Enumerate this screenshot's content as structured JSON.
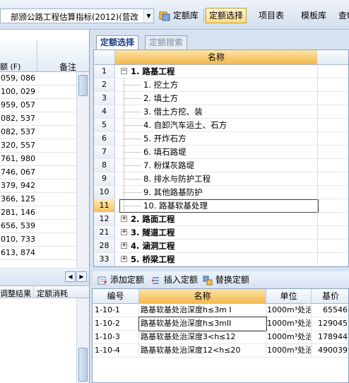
{
  "toolbar": {
    "project_combo": "部颁公路工程估算指标(2012)(营改",
    "btn_quota_lib": "定额库",
    "btn_quota_select": "定额选择",
    "btn_project_table": "项目表",
    "btn_template_lib": "模板库",
    "btn_cut": "查t"
  },
  "left_panel": {
    "header_col1": "额 (F)",
    "header_col2": "备注",
    "rows": [
      "059, 086",
      "100, 029",
      "959, 057",
      "082, 537",
      "082, 537",
      "320, 557",
      "761, 980",
      "746, 067",
      "379, 942",
      "366, 125",
      "281, 146",
      "656, 539",
      "010, 733",
      "613, 874"
    ],
    "bottom_header_col1": "调整结果",
    "bottom_header_col2": "定额消耗"
  },
  "tabs": {
    "quota_select": "定额选择",
    "quota_search": "定额搜索"
  },
  "tree": {
    "header": "名称",
    "rows": [
      {
        "num": "1",
        "label": "1. 路基工程",
        "level": 0,
        "expander": "−",
        "bold": true
      },
      {
        "num": "2",
        "label": "1. 挖土方",
        "level": 1
      },
      {
        "num": "3",
        "label": "2. 填土方",
        "level": 1
      },
      {
        "num": "4",
        "label": "3. 借土方挖、装",
        "level": 1
      },
      {
        "num": "5",
        "label": "4. 自卸汽车运土、石方",
        "level": 1
      },
      {
        "num": "6",
        "label": "5. 开炸石方",
        "level": 1
      },
      {
        "num": "7",
        "label": "6. 填石路堤",
        "level": 1
      },
      {
        "num": "8",
        "label": "7. 粉煤灰路堤",
        "level": 1
      },
      {
        "num": "9",
        "label": "8. 排水与防护工程",
        "level": 1
      },
      {
        "num": "10",
        "label": "9. 其他路基防护",
        "level": 1
      },
      {
        "num": "11",
        "label": "10. 路基软基处理",
        "level": 1,
        "selected": true
      },
      {
        "num": "12",
        "label": "2. 路面工程",
        "level": 0,
        "expander": "+",
        "bold": true
      },
      {
        "num": "21",
        "label": "3. 隧道工程",
        "level": 0,
        "expander": "+",
        "bold": true
      },
      {
        "num": "28",
        "label": "4. 涵洞工程",
        "level": 0,
        "expander": "+",
        "bold": true
      },
      {
        "num": "33",
        "label": "5. 桥梁工程",
        "level": 0,
        "expander": "+",
        "bold": true
      }
    ]
  },
  "bottom_toolbar": {
    "add_quota": "添加定额",
    "insert_quota": "插入定额",
    "replace_quota": "替换定额"
  },
  "quota_table": {
    "headers": [
      "编号",
      "名称",
      "单位",
      "基价"
    ],
    "rows": [
      {
        "code": "1-10-1",
        "name": "路基软基处治深度h≤3m I",
        "unit": "1000m³处治",
        "price": "65546"
      },
      {
        "code": "1-10-2",
        "name": "路基软基处治深度h≤3mII",
        "unit": "1000m³处治",
        "price": "129045"
      },
      {
        "code": "1-10-3",
        "name": "路基软基处治深度3<h≤12",
        "unit": "1000m³处治",
        "price": "178944"
      },
      {
        "code": "1-10-4",
        "name": "路基软基处治深度12<h≤20",
        "unit": "1000m³处治",
        "price": "490039"
      }
    ]
  },
  "colors": {
    "accent_header": "#f4b84a",
    "selection": "#ffde80",
    "panel_bg": "#d6e2f1"
  }
}
